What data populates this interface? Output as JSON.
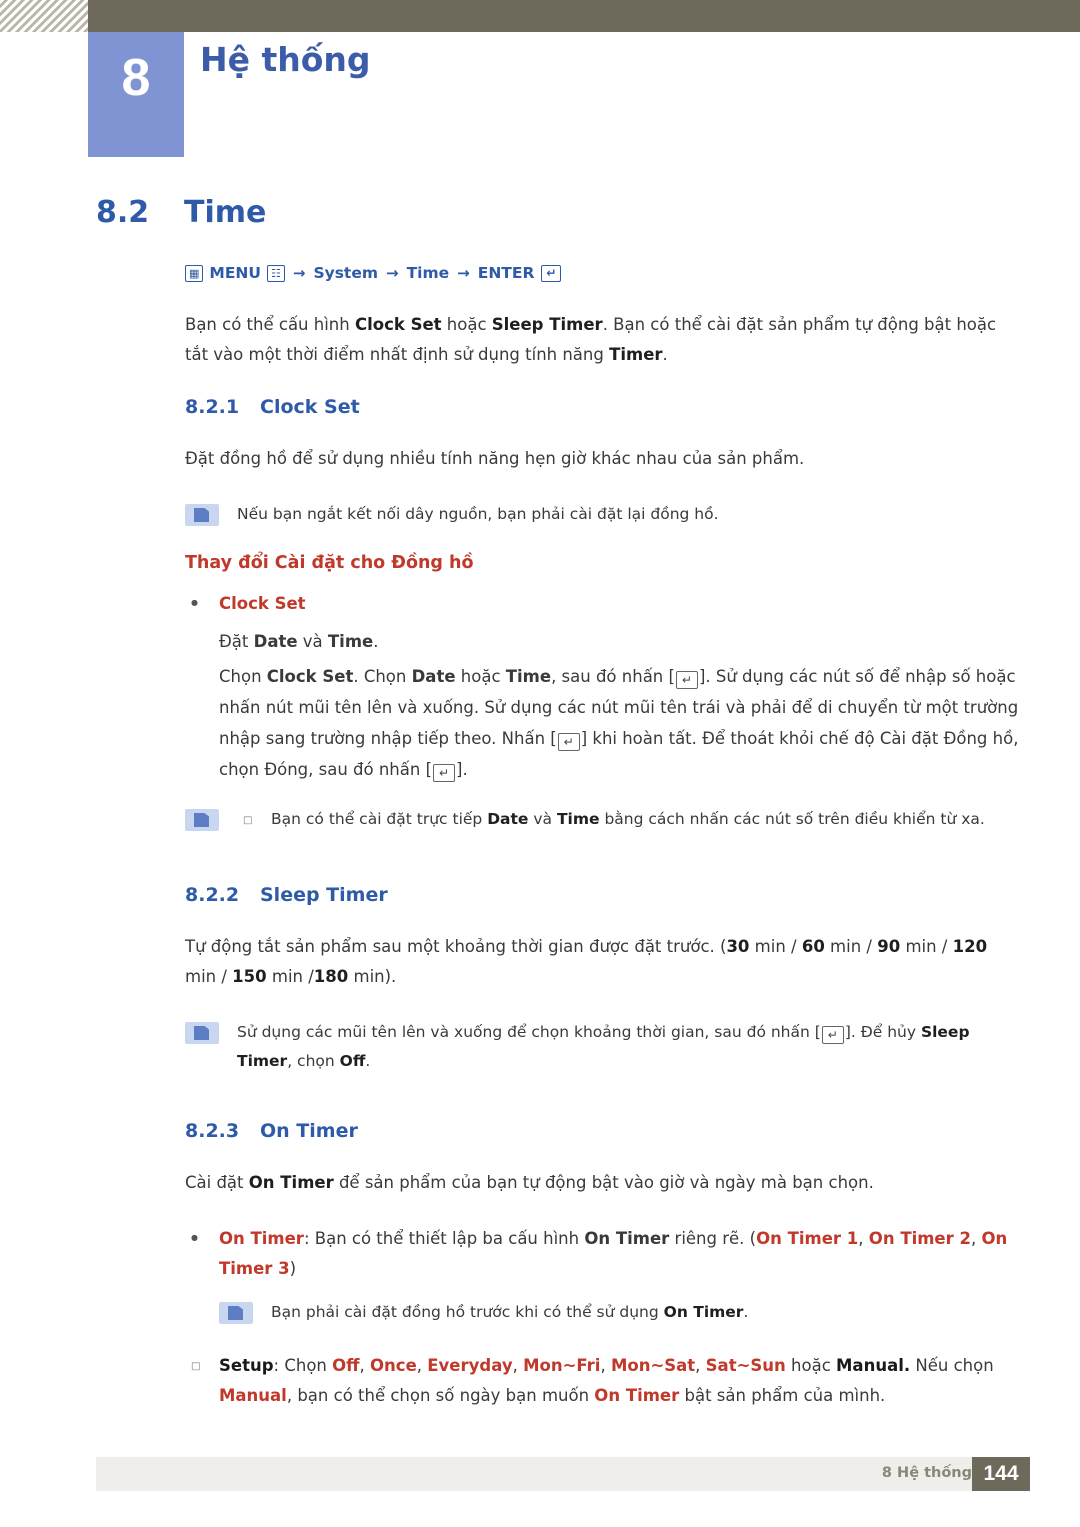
{
  "header": {
    "chapter_number": "8",
    "chapter_title": "Hệ thống"
  },
  "section": {
    "number": "8.2",
    "title": "Time"
  },
  "menu_path": {
    "menu_label": "MENU",
    "arrow": "→",
    "item1": "System",
    "item2": "Time",
    "enter_label": "ENTER"
  },
  "intro": {
    "text_1": "Bạn có thể cấu hình ",
    "b_clock_set": "Clock Set",
    "text_2": " hoặc ",
    "b_sleep_timer": "Sleep Timer",
    "text_3": ". Bạn có thể cài đặt sản phẩm tự động bật hoặc tắt vào một thời điểm nhất định sử dụng tính năng ",
    "b_timer": "Timer",
    "text_4": "."
  },
  "clock_set": {
    "num": "8.2.1",
    "title": "Clock Set",
    "body": "Đặt đồng hồ để sử dụng nhiều tính năng hẹn giờ khác nhau của sản phẩm.",
    "note": "Nếu bạn ngắt kết nối dây nguồn, bạn phải cài đặt lại đồng hồ.",
    "subhead": "Thay đổi Cài đặt cho Đồng hồ",
    "bullet_label": "Clock Set",
    "line1_a": "Đặt ",
    "line1_date": "Date",
    "line1_b": " và ",
    "line1_time": "Time",
    "line1_c": ".",
    "para_a": "Chọn ",
    "para_clockset": "Clock Set",
    "para_b": ". Chọn ",
    "para_date": "Date",
    "para_c": " hoặc ",
    "para_time": "Time",
    "para_d": ", sau đó nhấn [",
    "para_e": "]. Sử dụng các nút số để nhập số hoặc nhấn nút mũi tên lên và xuống. Sử dụng các nút mũi tên trái và phải để di chuyển từ một trường nhập sang trường nhập tiếp theo. Nhấn [",
    "para_f": "] khi hoàn tất. Để thoát khỏi chế độ Cài đặt Đồng hồ, chọn Đóng, sau đó nhấn [",
    "para_g": "].",
    "note2_a": "Bạn có thể cài đặt trực tiếp ",
    "note2_date": "Date",
    "note2_b": " và ",
    "note2_time": "Time",
    "note2_c": " bằng cách nhấn các nút số trên điều khiển từ xa."
  },
  "sleep_timer": {
    "num": "8.2.2",
    "title": "Sleep Timer",
    "body_a": "Tự động tắt sản phẩm sau một khoảng thời gian được đặt trước. (",
    "v30": "30",
    "body_b": " min / ",
    "v60": "60",
    "body_c": " min / ",
    "v90": "90",
    "body_d": " min / ",
    "v120": "120",
    "body_e": " min / ",
    "v150": "150",
    "body_f": " min /",
    "v180": "180",
    "body_g": " min).",
    "note_a": "Sử dụng các mũi tên lên và xuống để chọn khoảng thời gian, sau đó nhấn [",
    "note_b": "]. Để hủy ",
    "note_sleep": "Sleep Timer",
    "note_c": ", chọn ",
    "note_off": "Off",
    "note_d": "."
  },
  "on_timer": {
    "num": "8.2.3",
    "title": "On Timer",
    "body_a": "Cài đặt ",
    "b_on_timer": "On Timer",
    "body_b": " để sản phẩm của bạn tự động bật vào giờ và ngày mà bạn chọn.",
    "bullet_a": "On Timer",
    "bullet_b": ": Bạn có thể thiết lập ba cấu hình ",
    "bullet_c": "On Timer",
    "bullet_d": " riêng rẽ. (",
    "bullet_t1": "On Timer 1",
    "bullet_sep": ", ",
    "bullet_t2": "On Timer 2",
    "bullet_t3": "On Timer 3",
    "bullet_e": ")",
    "note_a": "Bạn phải cài đặt đồng hồ trước khi có thể sử dụng ",
    "note_on_timer": "On Timer",
    "note_b": ".",
    "setup_label": "Setup",
    "setup_a": ": Chọn ",
    "opt_off": "Off",
    "opt_once": "Once",
    "opt_everyday": "Everyday",
    "opt_monfri": "Mon~Fri",
    "opt_monsat": "Mon~Sat",
    "opt_satsun": "Sat~Sun",
    "setup_b": " hoặc ",
    "opt_manual": "Manual.",
    "setup_c": " Nếu chọn ",
    "opt_manual2": "Manual",
    "setup_d": ", bạn có thể chọn số ngày bạn muốn ",
    "setup_on_timer": "On Timer",
    "setup_e": " bật sản phẩm của mình."
  },
  "footer": {
    "text": "8 Hệ thống",
    "page": "144"
  },
  "icons": {
    "menu_icon": "menu-grid-icon",
    "enter_icon": "enter-arrow-icon",
    "note_icon": "note-pencil-icon"
  },
  "colors": {
    "accent_blue": "#2e5aa8",
    "badge_blue": "#8094d4",
    "header_olive": "#6d6a5c",
    "highlight_red": "#c0392b"
  }
}
